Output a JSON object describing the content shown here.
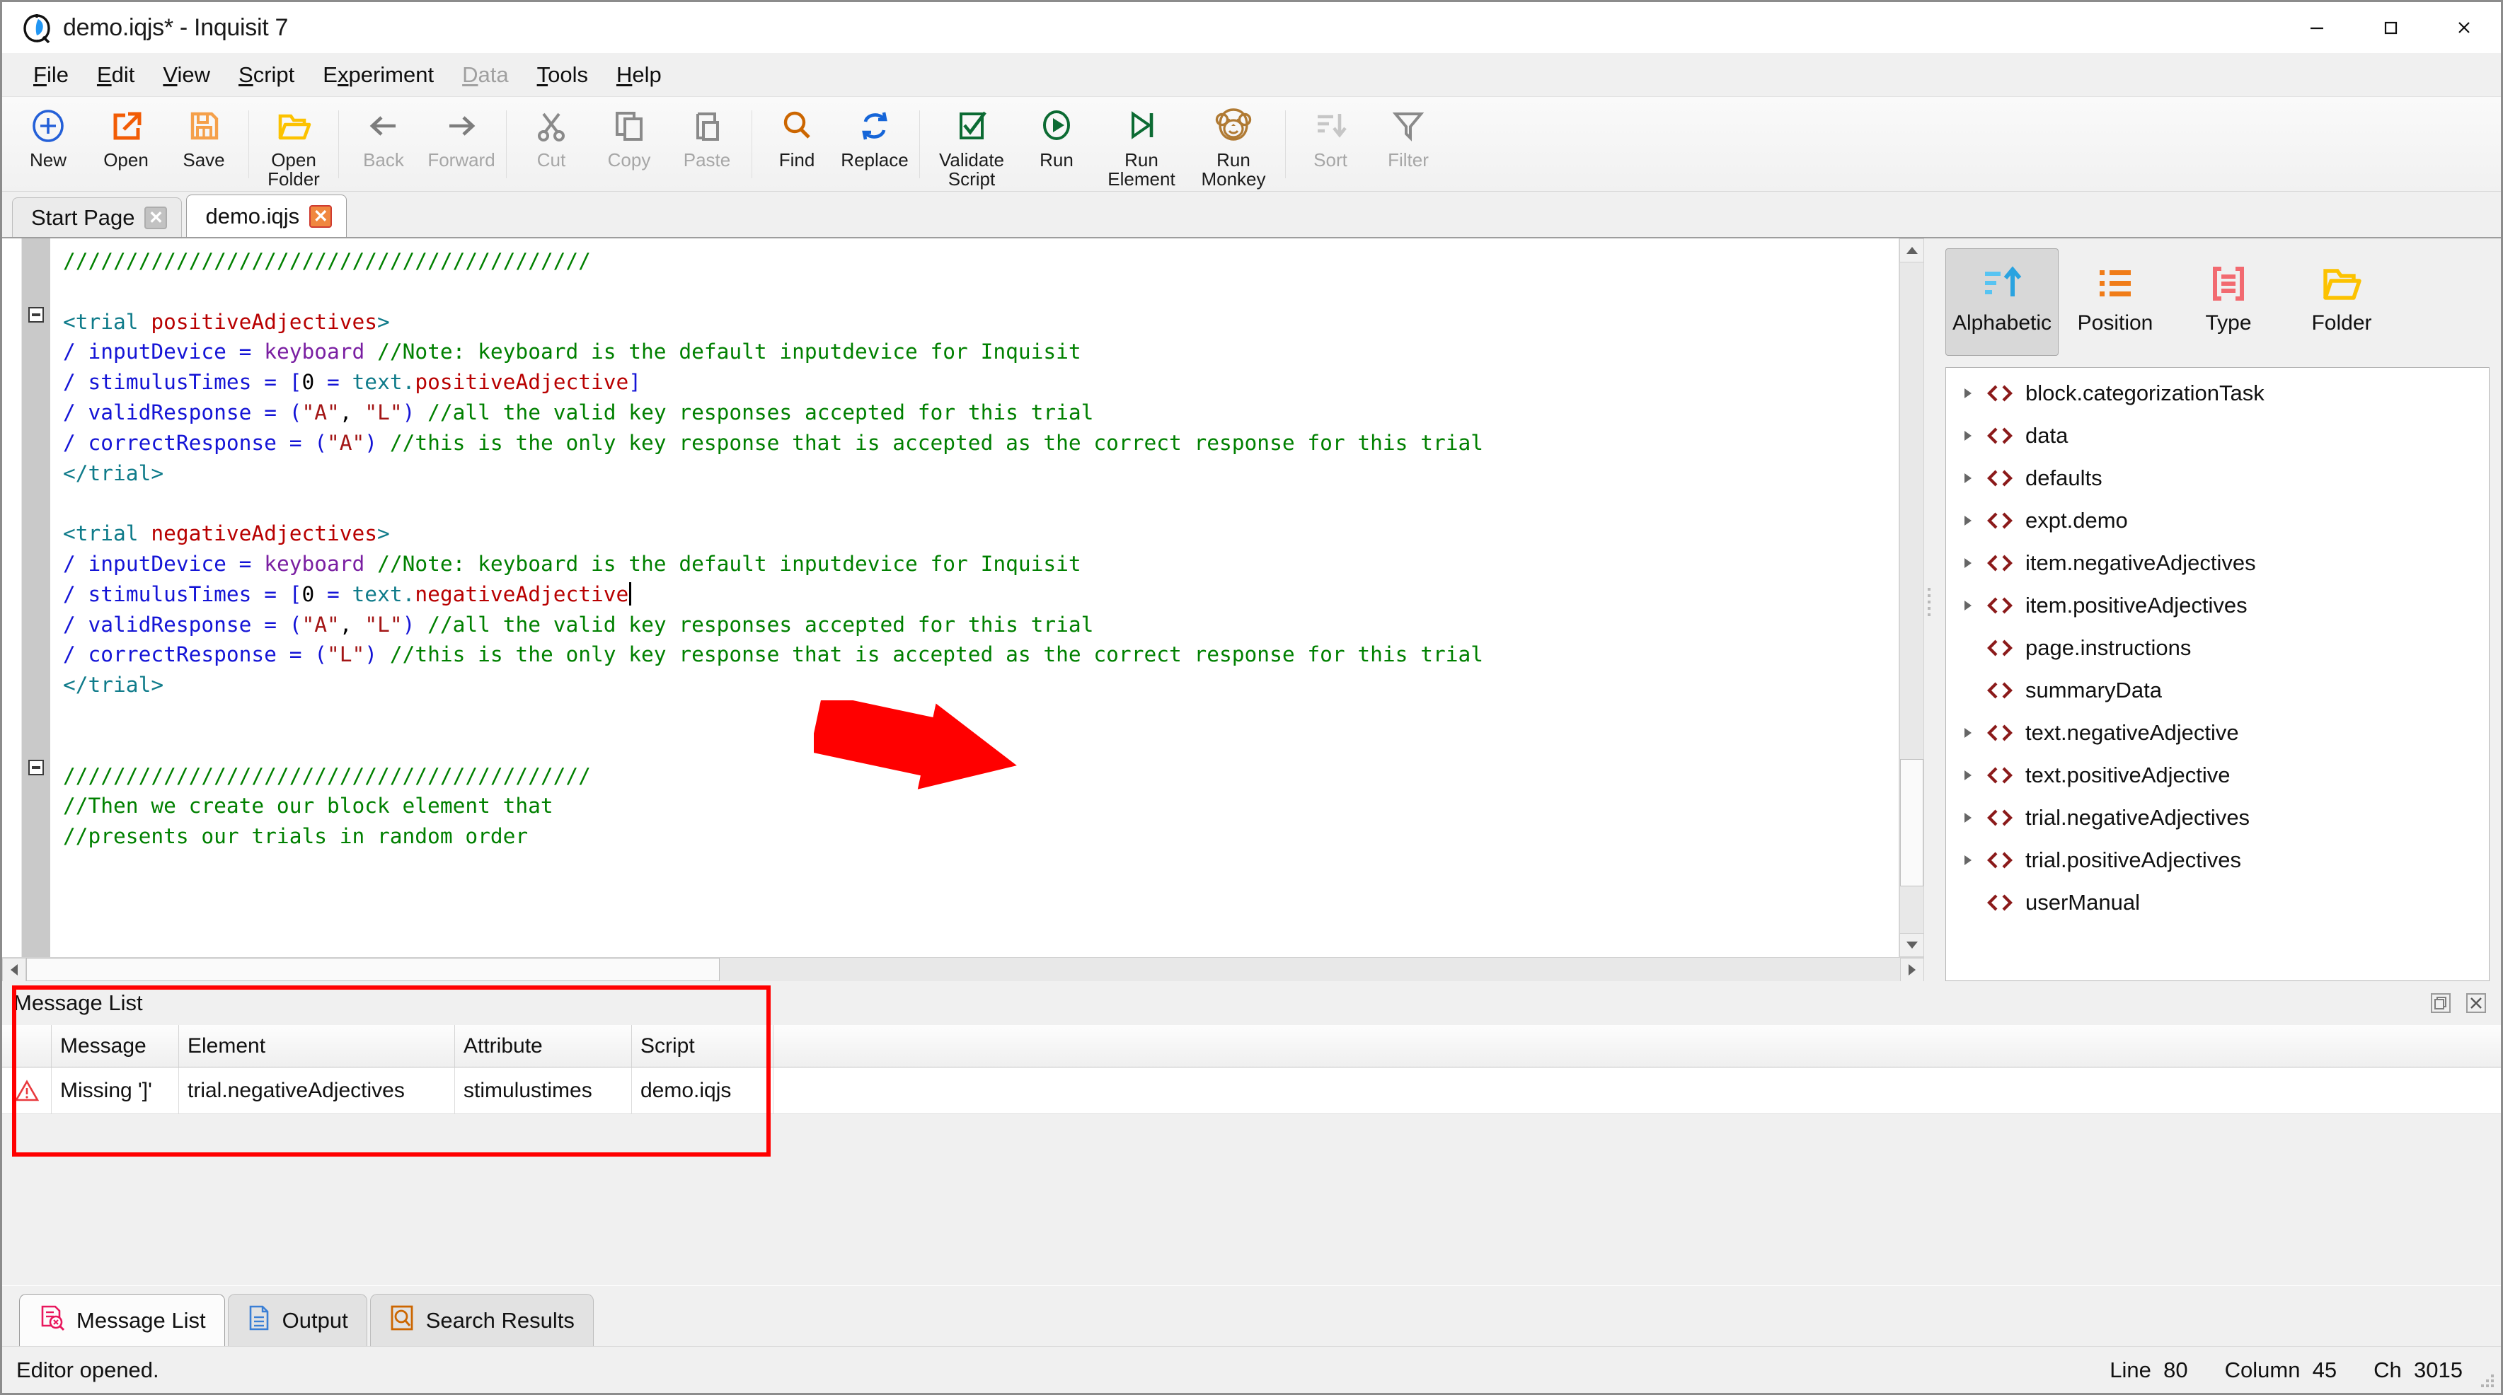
{
  "window": {
    "title": "demo.iqjs* - Inquisit 7",
    "app_icon": "inquisit-logo-icon",
    "minimize": "minimize-icon",
    "maximize": "maximize-icon",
    "close": "close-icon"
  },
  "menubar": {
    "items": [
      {
        "label": "File",
        "mnemonic": "F",
        "disabled": false
      },
      {
        "label": "Edit",
        "mnemonic": "E",
        "disabled": false
      },
      {
        "label": "View",
        "mnemonic": "V",
        "disabled": false
      },
      {
        "label": "Script",
        "mnemonic": "S",
        "disabled": false
      },
      {
        "label": "Experiment",
        "mnemonic": "x",
        "disabled": false
      },
      {
        "label": "Data",
        "mnemonic": "D",
        "disabled": true
      },
      {
        "label": "Tools",
        "mnemonic": "T",
        "disabled": false
      },
      {
        "label": "Help",
        "mnemonic": "H",
        "disabled": false
      }
    ]
  },
  "toolbar": {
    "buttons": [
      {
        "label": "New",
        "icon": "plus-circle-icon",
        "disabled": false
      },
      {
        "label": "Open",
        "icon": "open-arrow-icon",
        "disabled": false
      },
      {
        "label": "Save",
        "icon": "floppy-disk-icon",
        "disabled": false
      },
      {
        "label": "Open\nFolder",
        "icon": "folder-open-icon",
        "disabled": false
      },
      {
        "label": "Back",
        "icon": "arrow-left-icon",
        "disabled": true
      },
      {
        "label": "Forward",
        "icon": "arrow-right-icon",
        "disabled": true
      },
      {
        "label": "Cut",
        "icon": "scissors-icon",
        "disabled": true
      },
      {
        "label": "Copy",
        "icon": "copy-icon",
        "disabled": true
      },
      {
        "label": "Paste",
        "icon": "paste-icon",
        "disabled": true
      },
      {
        "label": "Find",
        "icon": "magnifier-icon",
        "disabled": false
      },
      {
        "label": "Replace",
        "icon": "replace-loop-icon",
        "disabled": false
      },
      {
        "label": "Validate\nScript",
        "icon": "checkbox-check-icon",
        "disabled": false
      },
      {
        "label": "Run",
        "icon": "play-circle-icon",
        "disabled": false
      },
      {
        "label": "Run\nElement",
        "icon": "play-to-end-icon",
        "disabled": false
      },
      {
        "label": "Run\nMonkey",
        "icon": "monkey-icon",
        "disabled": false
      },
      {
        "label": "Sort",
        "icon": "sort-descending-icon",
        "disabled": true
      },
      {
        "label": "Filter",
        "icon": "funnel-icon",
        "disabled": true
      }
    ]
  },
  "document_tabs": [
    {
      "label": "Start Page",
      "active": false,
      "close_icon": "close-icon"
    },
    {
      "label": "demo.iqjs",
      "active": true,
      "close_icon": "close-icon"
    }
  ],
  "editor": {
    "lines": [
      {
        "fold": false,
        "tokens": [
          {
            "t": "//////////////////////////////////////////",
            "c": "cm"
          }
        ]
      },
      {
        "fold": false,
        "tokens": []
      },
      {
        "fold": true,
        "tokens": [
          {
            "t": "<trial ",
            "c": "tg"
          },
          {
            "t": "positiveAdjectives",
            "c": "nm"
          },
          {
            "t": ">",
            "c": "tg"
          }
        ]
      },
      {
        "fold": false,
        "tokens": [
          {
            "t": "/ ",
            "c": "at"
          },
          {
            "t": "inputDevice ",
            "c": "at"
          },
          {
            "t": "= ",
            "c": "br"
          },
          {
            "t": "keyboard ",
            "c": "vl"
          },
          {
            "t": "//Note: keyboard is the default inputdevice for Inquisit",
            "c": "cm"
          }
        ]
      },
      {
        "fold": false,
        "tokens": [
          {
            "t": "/ ",
            "c": "at"
          },
          {
            "t": "stimulusTimes ",
            "c": "at"
          },
          {
            "t": "= ",
            "c": "br"
          },
          {
            "t": "[",
            "c": "br"
          },
          {
            "t": "0 ",
            "c": "op"
          },
          {
            "t": "= ",
            "c": "br"
          },
          {
            "t": "text.",
            "c": "tg"
          },
          {
            "t": "positiveAdjective",
            "c": "nm"
          },
          {
            "t": "]",
            "c": "br"
          }
        ]
      },
      {
        "fold": false,
        "tokens": [
          {
            "t": "/ ",
            "c": "at"
          },
          {
            "t": "validResponse ",
            "c": "at"
          },
          {
            "t": "= ",
            "c": "br"
          },
          {
            "t": "(",
            "c": "br"
          },
          {
            "t": "\"A\"",
            "c": "st"
          },
          {
            "t": ", ",
            "c": "op"
          },
          {
            "t": "\"L\"",
            "c": "st"
          },
          {
            "t": ") ",
            "c": "br"
          },
          {
            "t": "//all the valid key responses accepted for this trial",
            "c": "cm"
          }
        ]
      },
      {
        "fold": false,
        "tokens": [
          {
            "t": "/ ",
            "c": "at"
          },
          {
            "t": "correctResponse ",
            "c": "at"
          },
          {
            "t": "= ",
            "c": "br"
          },
          {
            "t": "(",
            "c": "br"
          },
          {
            "t": "\"A\"",
            "c": "st"
          },
          {
            "t": ") ",
            "c": "br"
          },
          {
            "t": "//this is the only key response that is accepted as the correct response for this trial",
            "c": "cm"
          }
        ]
      },
      {
        "fold": false,
        "tokens": [
          {
            "t": "</trial>",
            "c": "tg"
          }
        ]
      },
      {
        "fold": false,
        "tokens": []
      },
      {
        "fold": true,
        "tokens": [
          {
            "t": "<trial ",
            "c": "tg"
          },
          {
            "t": "negativeAdjectives",
            "c": "nm"
          },
          {
            "t": ">",
            "c": "tg"
          }
        ]
      },
      {
        "fold": false,
        "tokens": [
          {
            "t": "/ ",
            "c": "at"
          },
          {
            "t": "inputDevice ",
            "c": "at"
          },
          {
            "t": "= ",
            "c": "br"
          },
          {
            "t": "keyboard ",
            "c": "vl"
          },
          {
            "t": "//Note: keyboard is the default inputdevice for Inquisit",
            "c": "cm"
          }
        ]
      },
      {
        "fold": false,
        "caret": true,
        "tokens": [
          {
            "t": "/ ",
            "c": "at"
          },
          {
            "t": "stimulusTimes ",
            "c": "at"
          },
          {
            "t": "= ",
            "c": "br"
          },
          {
            "t": "[",
            "c": "br"
          },
          {
            "t": "0 ",
            "c": "op"
          },
          {
            "t": "= ",
            "c": "br"
          },
          {
            "t": "text.",
            "c": "tg"
          },
          {
            "t": "negativeAdjective",
            "c": "nm"
          }
        ]
      },
      {
        "fold": false,
        "tokens": [
          {
            "t": "/ ",
            "c": "at"
          },
          {
            "t": "validResponse ",
            "c": "at"
          },
          {
            "t": "= ",
            "c": "br"
          },
          {
            "t": "(",
            "c": "br"
          },
          {
            "t": "\"A\"",
            "c": "st"
          },
          {
            "t": ", ",
            "c": "op"
          },
          {
            "t": "\"L\"",
            "c": "st"
          },
          {
            "t": ") ",
            "c": "br"
          },
          {
            "t": "//all the valid key responses accepted for this trial",
            "c": "cm"
          }
        ]
      },
      {
        "fold": false,
        "tokens": [
          {
            "t": "/ ",
            "c": "at"
          },
          {
            "t": "correctResponse ",
            "c": "at"
          },
          {
            "t": "= ",
            "c": "br"
          },
          {
            "t": "(",
            "c": "br"
          },
          {
            "t": "\"L\"",
            "c": "st"
          },
          {
            "t": ") ",
            "c": "br"
          },
          {
            "t": "//this is the only key response that is accepted as the correct response for this trial",
            "c": "cm"
          }
        ]
      },
      {
        "fold": false,
        "tokens": [
          {
            "t": "</trial>",
            "c": "tg"
          }
        ]
      },
      {
        "fold": false,
        "tokens": []
      },
      {
        "fold": false,
        "tokens": []
      },
      {
        "fold": false,
        "tokens": [
          {
            "t": "//////////////////////////////////////////",
            "c": "cm"
          }
        ]
      },
      {
        "fold": false,
        "tokens": [
          {
            "t": "//Then we create our block element that",
            "c": "cm"
          }
        ]
      },
      {
        "fold": false,
        "tokens": [
          {
            "t": "//presents our trials in random order",
            "c": "cm"
          }
        ]
      }
    ]
  },
  "element_panel": {
    "sort_buttons": [
      {
        "label": "Alphabetic",
        "icon": "sort-alpha-up-icon",
        "selected": true
      },
      {
        "label": "Position",
        "icon": "list-bullets-icon",
        "selected": false
      },
      {
        "label": "Type",
        "icon": "type-brackets-icon",
        "selected": false
      },
      {
        "label": "Folder",
        "icon": "folder-open-icon",
        "selected": false
      }
    ],
    "tree_items": [
      {
        "label": "block.categorizationTask",
        "expandable": true
      },
      {
        "label": "data",
        "expandable": true
      },
      {
        "label": "defaults",
        "expandable": true
      },
      {
        "label": "expt.demo",
        "expandable": true
      },
      {
        "label": "item.negativeAdjectives",
        "expandable": true
      },
      {
        "label": "item.positiveAdjectives",
        "expandable": true
      },
      {
        "label": "page.instructions",
        "expandable": false
      },
      {
        "label": "summaryData",
        "expandable": false
      },
      {
        "label": "text.negativeAdjective",
        "expandable": true
      },
      {
        "label": "text.positiveAdjective",
        "expandable": true
      },
      {
        "label": "trial.negativeAdjectives",
        "expandable": true
      },
      {
        "label": "trial.positiveAdjectives",
        "expandable": true
      },
      {
        "label": "userManual",
        "expandable": false
      }
    ]
  },
  "message_dock": {
    "title": "Message List",
    "float_icon": "float-window-icon",
    "close_icon": "close-icon",
    "columns": [
      "",
      "Message",
      "Element",
      "Attribute",
      "Script"
    ],
    "rows": [
      {
        "severity_icon": "error-triangle-icon",
        "message": "Missing ']'",
        "element": "trial.negativeAdjectives",
        "attribute": "stimulustimes",
        "script": "demo.iqjs"
      }
    ]
  },
  "bottom_tabs": [
    {
      "label": "Message List",
      "icon": "message-list-icon",
      "active": true
    },
    {
      "label": "Output",
      "icon": "output-doc-icon",
      "active": false
    },
    {
      "label": "Search Results",
      "icon": "search-results-icon",
      "active": false
    }
  ],
  "statusbar": {
    "message": "Editor opened.",
    "line_label": "Line",
    "line_value": "80",
    "column_label": "Column",
    "column_value": "45",
    "ch_label": "Ch",
    "ch_value": "3015"
  },
  "annotation": {
    "arrow_color": "#ff0000",
    "highlight_color": "#ff0000"
  },
  "colors": {
    "comment": "#008000",
    "tag": "#0f7b8a",
    "name": "#b80000",
    "attribute": "#1414d6",
    "value": "#7a1fa2",
    "string": "#a31515"
  }
}
